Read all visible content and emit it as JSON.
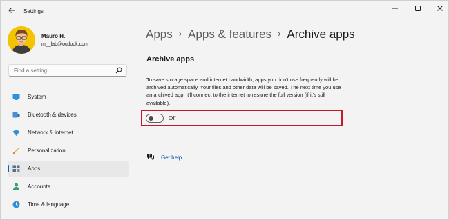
{
  "window": {
    "title": "Settings"
  },
  "user": {
    "name": "Mauro H.",
    "email": "m__lab@outlook.com"
  },
  "search": {
    "placeholder": "Find a setting"
  },
  "sidebar": {
    "items": [
      {
        "label": "System",
        "icon": "system-icon",
        "selected": false
      },
      {
        "label": "Bluetooth & devices",
        "icon": "bluetooth-icon",
        "selected": false
      },
      {
        "label": "Network & internet",
        "icon": "wifi-icon",
        "selected": false
      },
      {
        "label": "Personalization",
        "icon": "brush-icon",
        "selected": false
      },
      {
        "label": "Apps",
        "icon": "apps-icon",
        "selected": true
      },
      {
        "label": "Accounts",
        "icon": "person-icon",
        "selected": false
      },
      {
        "label": "Time & language",
        "icon": "globe-clock-icon",
        "selected": false
      }
    ]
  },
  "breadcrumb": {
    "items": [
      "Apps",
      "Apps & features",
      "Archive apps"
    ],
    "separator": "›"
  },
  "main": {
    "section_title": "Archive apps",
    "description": "To save storage space and internet bandwidth, apps you don't use frequently will be archived automatically. Your files and other data will be saved. The next time you use an archived app, it'll connect to the internet to restore the full version (if it's still available).",
    "toggle": {
      "state": "Off",
      "on": false
    },
    "help_link": "Get help"
  },
  "colors": {
    "accent": "#0067c0",
    "highlight_border": "#c21a2b",
    "window_bg": "#f3f3f3",
    "link": "#0052a3"
  }
}
